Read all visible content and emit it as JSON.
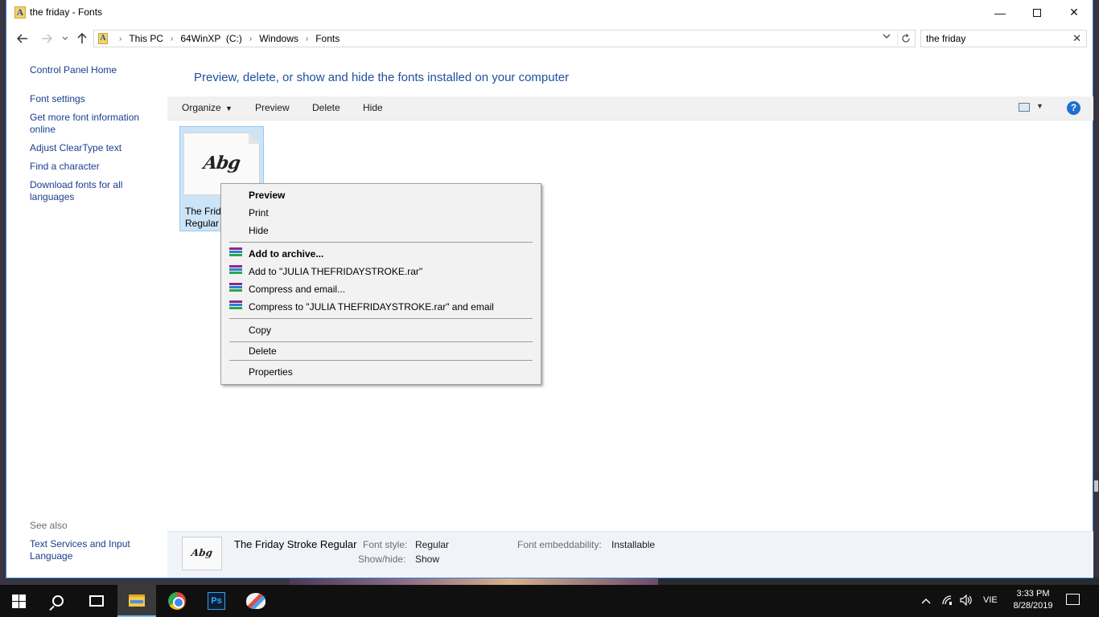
{
  "window": {
    "title": "the friday - Fonts",
    "minimize": "—",
    "close": "✕"
  },
  "address": {
    "crumbs": [
      "This PC",
      "64WinXP  (C:)",
      "Windows",
      "Fonts"
    ],
    "search_value": "the friday"
  },
  "left_pane": {
    "links": [
      "Control Panel Home",
      "Font settings",
      "Get more font information online",
      "Adjust ClearType text",
      "Find a character",
      "Download fonts for all languages"
    ],
    "see_also_label": "See also",
    "see_also_links": [
      "Text Services and Input Language"
    ]
  },
  "main": {
    "heading": "Preview, delete, or show and hide the fonts installed on your computer",
    "toolbar": {
      "organize": "Organize",
      "preview": "Preview",
      "delete": "Delete",
      "hide": "Hide",
      "help": "?"
    },
    "font_tile": {
      "sample": "Abg",
      "label_line1": "The Frida",
      "label_line2": "Regular"
    }
  },
  "context_menu": {
    "items": [
      {
        "label": "Preview",
        "bold": true
      },
      {
        "label": "Print"
      },
      {
        "label": "Hide"
      },
      {
        "label": "Add to archive...",
        "bold": true,
        "icon": "winrar-icon"
      },
      {
        "label": "Add to \"JULIA THEFRIDAYSTROKE.rar\"",
        "icon": "winrar-icon"
      },
      {
        "label": "Compress and email...",
        "icon": "winrar-icon"
      },
      {
        "label": "Compress to \"JULIA THEFRIDAYSTROKE.rar\" and email",
        "icon": "winrar-icon"
      },
      {
        "label": "Copy"
      },
      {
        "label": "Delete"
      },
      {
        "label": "Properties"
      }
    ]
  },
  "details": {
    "sample": "Abg",
    "font_name": "The Friday Stroke Regular",
    "font_style_label": "Font style:",
    "font_style_value": "Regular",
    "showhide_label": "Show/hide:",
    "showhide_value": "Show",
    "embed_label": "Font embeddability:",
    "embed_value": "Installable"
  },
  "taskbar": {
    "ps_label": "Ps",
    "language": "VIE",
    "time": "3:33 PM",
    "date": "8/28/2019"
  },
  "colors": {
    "accent": "#1e4fa0",
    "link": "#1a3e8c",
    "selection": "#cce4f7",
    "taskbar": "#101010"
  }
}
